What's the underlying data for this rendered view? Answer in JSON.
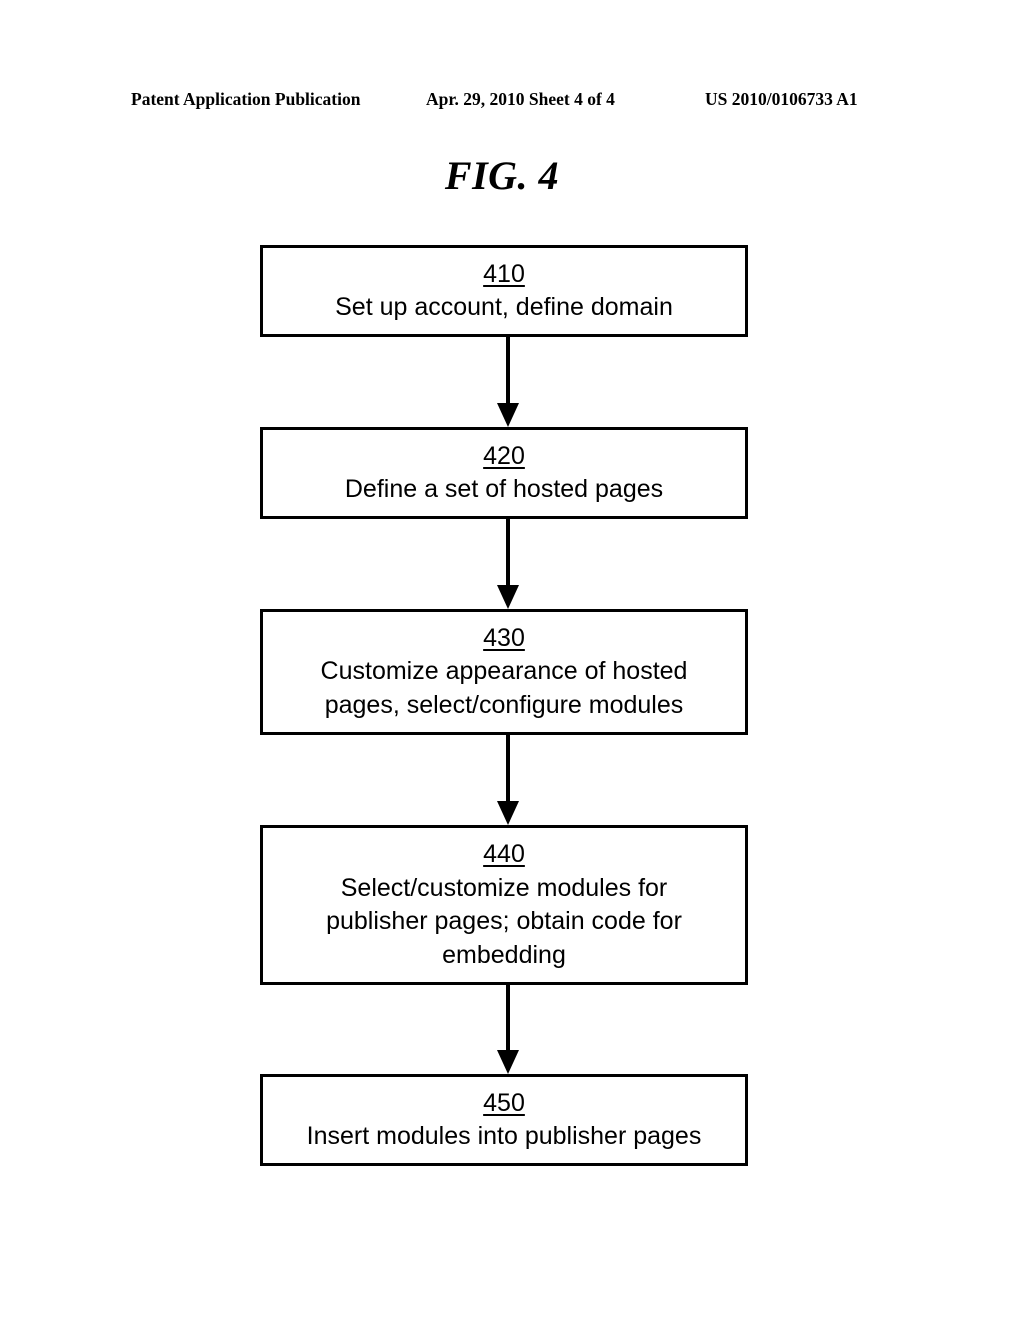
{
  "header": {
    "left": "Patent Application Publication",
    "middle": "Apr. 29, 2010  Sheet 4 of 4",
    "right": "US 2010/0106733 A1"
  },
  "figure": {
    "title": "FIG. 4"
  },
  "flowchart": {
    "steps": [
      {
        "number": "410",
        "label": "Set up account, define domain"
      },
      {
        "number": "420",
        "label": "Define a set of hosted pages"
      },
      {
        "number": "430",
        "label": "Customize appearance of hosted\npages, select/configure modules"
      },
      {
        "number": "440",
        "label": "Select/customize modules for\npublisher pages; obtain code for\nembedding"
      },
      {
        "number": "450",
        "label": "Insert modules into publisher pages"
      }
    ],
    "edges": [
      {
        "from": "410",
        "to": "420"
      },
      {
        "from": "420",
        "to": "430"
      },
      {
        "from": "430",
        "to": "440"
      },
      {
        "from": "440",
        "to": "450"
      }
    ]
  }
}
